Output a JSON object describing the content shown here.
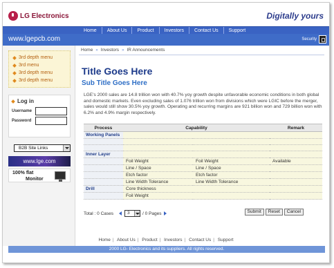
{
  "header": {
    "logo_text": "LG Electronics",
    "slogan": "Digitally yours",
    "site_url": "www.lgepcb.com",
    "security_label": "Security"
  },
  "topnav": [
    "Home",
    "About Us",
    "Product",
    "Investors",
    "Contact Us",
    "Support"
  ],
  "sidebar": {
    "menu_items": [
      "3rd depth menu",
      "3rd menu",
      "3rd depth menu",
      "3rd depth menu"
    ],
    "login": {
      "title": "Log in",
      "username_label": "Username",
      "password_label": "Password",
      "username_value": "",
      "password_value": ""
    },
    "b2b_select": "B2B Site Links",
    "banner_url": "www.lge.com",
    "banner_flat_line1": "100% flat",
    "banner_flat_line2": "Monitor"
  },
  "breadcrumb": [
    "Home",
    "Investors",
    "IR Announcements"
  ],
  "main": {
    "title": "Title Goes Here",
    "subtitle": "Sub Title Goes Here",
    "paragraph": "LGE's 2000 sales are 14.8 trillion won with 40.7% yoy growth despite unfavorable economic conditions in both global and domestic markets. Even excluding sales of 1.076 trillion won from divisions which were LGIC before the merger, sales would still show 30.5% yoy growth. Operating and recurring margins are 921 billion won and 729 billion won with 6.2% and 4.9% margin respectively."
  },
  "table": {
    "headers": [
      "Process",
      "Capability",
      "Remark"
    ],
    "working_panels": "Working Panels",
    "inner_layer": "Inner Layer",
    "drill": "Drill",
    "inner_rows": [
      [
        "Foil Weight",
        "Foil Weight",
        "Available"
      ],
      [
        "Line / Space",
        "Line / Space",
        ""
      ],
      [
        "Etch factor",
        "Etch factor",
        ""
      ],
      [
        "Line Width Tolerance",
        "Line Width Tolerance",
        ""
      ]
    ],
    "drill_rows": [
      [
        "Core thickness",
        "",
        ""
      ],
      [
        "Foil Weight",
        "",
        ""
      ]
    ]
  },
  "pager": {
    "total_label": "Total : 0 Cases",
    "current_page": "3",
    "pages_label": "/ 0 Pages",
    "buttons": [
      "Submit",
      "Reset",
      "Cancel"
    ]
  },
  "footer": {
    "links": [
      "Home",
      "About Us",
      "Product",
      "Investors",
      "Contact Us",
      "Support"
    ],
    "copyright": "2000 LG- Electronics and its suppliers. All rights reserved."
  }
}
